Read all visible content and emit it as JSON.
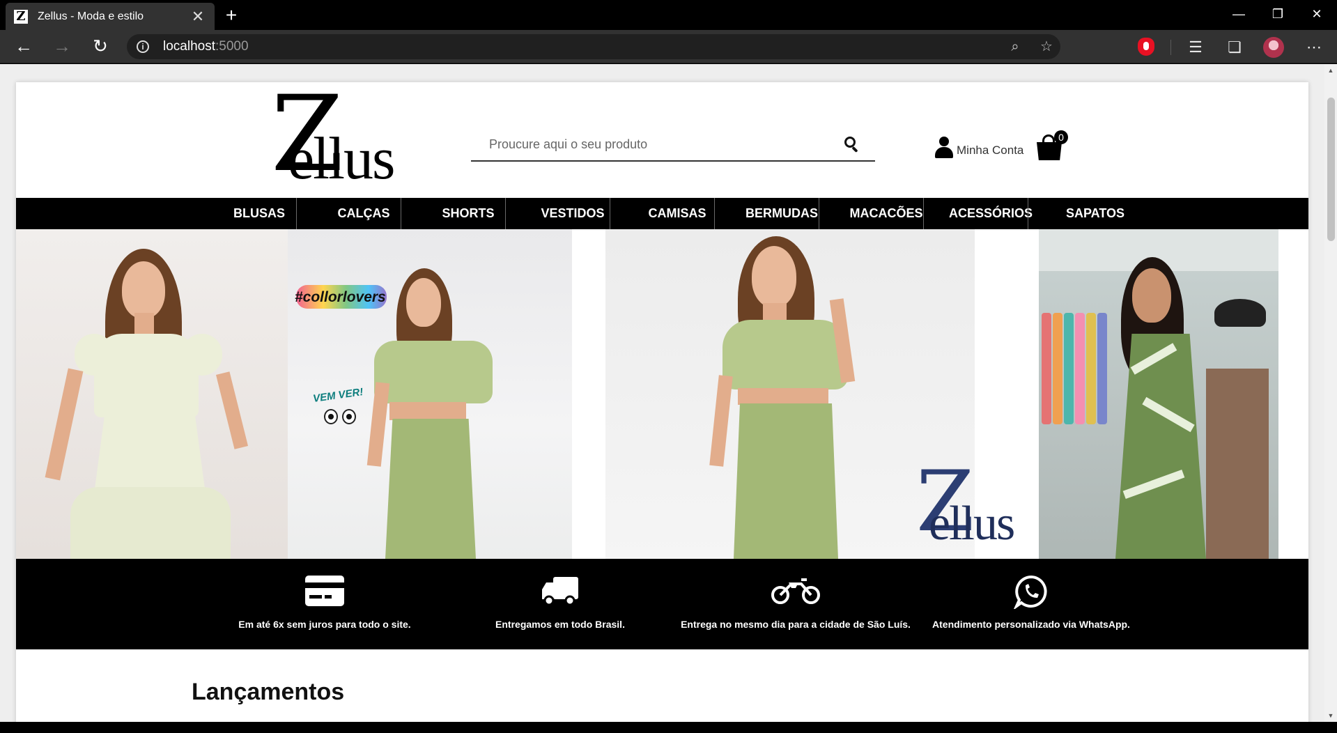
{
  "browser": {
    "tab_title": "Zellus - Moda e estilo",
    "favicon_letter": "Z",
    "tab_close": "✕",
    "new_tab": "+",
    "url_host": "localhost",
    "url_port": ":5000",
    "window_controls": {
      "minimize": "—",
      "restore": "❐",
      "close": "✕"
    },
    "icons": [
      "back-icon",
      "forward-icon",
      "refresh-icon",
      "info-icon",
      "zoom-icon",
      "favorite-star-icon",
      "extension-icon",
      "favorites-icon",
      "collections-icon",
      "profile-avatar",
      "more-icon"
    ]
  },
  "header": {
    "logo_z": "Z",
    "logo_rest": "ellus",
    "search_placeholder": "Proucure aqui o seu produto",
    "account_label": "Minha Conta",
    "cart_count": "0"
  },
  "categories": [
    "BLUSAS",
    "CALÇAS",
    "SHORTS",
    "VESTIDOS",
    "CAMISAS",
    "BERMUDAS",
    "MACACÕES",
    "ACESSÓRIOS",
    "SAPATOS"
  ],
  "hero": {
    "tag": "#collorlovers",
    "sticker": "VEM VER!",
    "logo_z": "Z",
    "logo_rest": "ellus"
  },
  "features": [
    {
      "icon": "credit-card-icon",
      "text": "Em até 6x sem juros para todo o site."
    },
    {
      "icon": "truck-icon",
      "text": "Entregamos em todo Brasil."
    },
    {
      "icon": "motorcycle-icon",
      "text": "Entrega no mesmo dia para a cidade de São Luís."
    },
    {
      "icon": "whatsapp-icon",
      "text": "Atendimento personalizado via WhatsApp."
    }
  ],
  "sections": {
    "launches_title": "Lançamentos"
  }
}
